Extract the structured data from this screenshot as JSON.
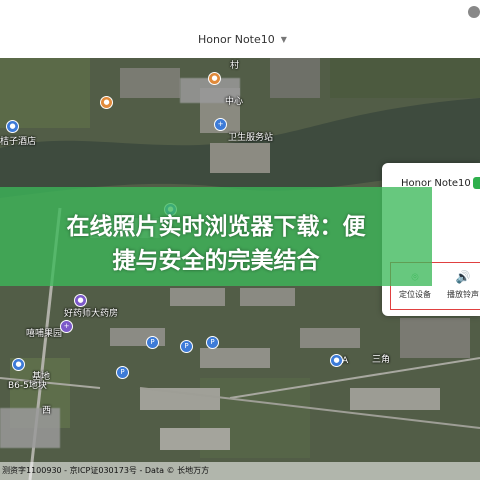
{
  "header": {
    "device_name": "Honor Note10",
    "dropdown_icon": "caret-down"
  },
  "map": {
    "labels": {
      "village": "村",
      "center": "中心",
      "health_station": "卫生服务站",
      "hotel": "桔子酒店",
      "pharmacy": "好药师大药房",
      "fruit": "嘻哺果园",
      "base": "基地",
      "bldg_b65": "B6-5地块",
      "area_a": "A",
      "san_jiao": "三角",
      "west_road": "西"
    },
    "footer": "测资字1100930 - 京ICP证030173号 - Data © 长地万方"
  },
  "device_panel": {
    "title": "Honor Note10",
    "status_color": "#2fb04d",
    "actions": [
      {
        "icon": "location-pin-icon",
        "label": "定位设备"
      },
      {
        "icon": "speaker-icon",
        "label": "播放铃声"
      }
    ]
  },
  "overlay_banner": {
    "line1": "在线照片实时浏览器下载：便",
    "line2": "捷与安全的完美结合",
    "color": "#3cb95a"
  }
}
